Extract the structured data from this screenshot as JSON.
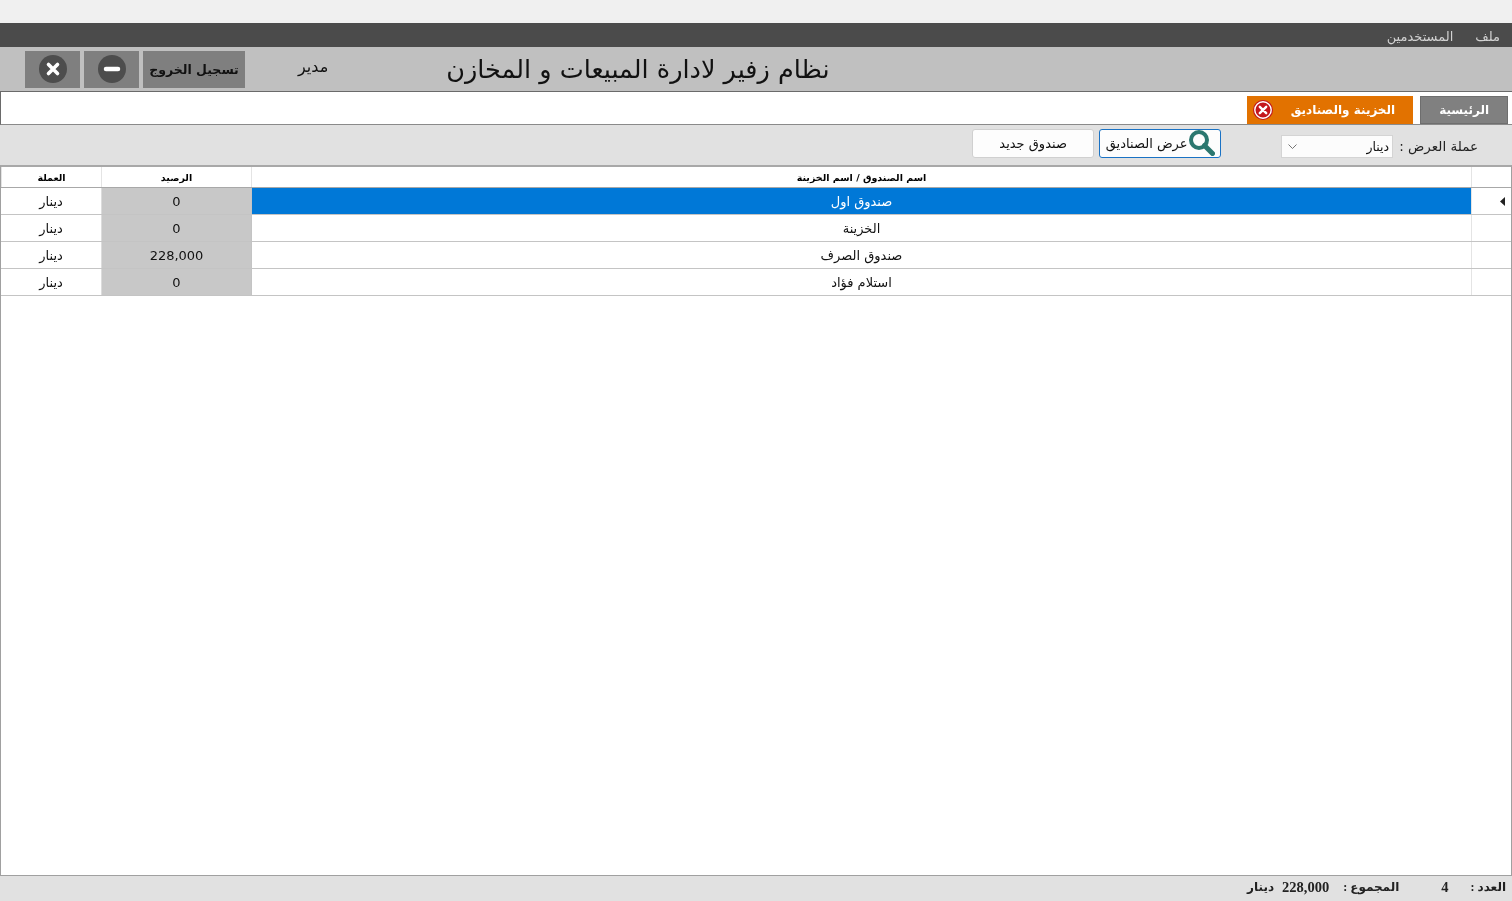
{
  "menu_bar": {
    "items": [
      "ملف",
      "المستخدمين"
    ]
  },
  "header": {
    "title": "نظام زفير لادارة المبيعات و المخازن",
    "user": "مدير",
    "logout_button": "تسجيل الخروج"
  },
  "tabs": [
    {
      "label": "الرئيسية",
      "selected": false,
      "closable": false
    },
    {
      "label": "الخزينة والصناديق",
      "selected": true,
      "closable": true
    }
  ],
  "toolbar": {
    "currency_label": "عملة العرض :",
    "currency_select": {
      "value": "دينار"
    },
    "buttons": [
      {
        "label": "عرض الصناديق",
        "kind": "search",
        "focused": true
      },
      {
        "label": "صندوق جديد",
        "kind": "plain",
        "focused": false
      }
    ]
  },
  "table": {
    "columns": [
      "اسم الصندوق / اسم الخزينة",
      "الرصيد",
      "العملة"
    ],
    "rows": [
      {
        "name": "صندوق اول",
        "balance": "0",
        "currency": "دينار",
        "selected": true
      },
      {
        "name": "الخزينة",
        "balance": "0",
        "currency": "دينار",
        "selected": false
      },
      {
        "name": "صندوق الصرف",
        "balance": "228,000",
        "currency": "دينار",
        "selected": false
      },
      {
        "name": "استلام فؤاد",
        "balance": "0",
        "currency": "دينار",
        "selected": false
      }
    ]
  },
  "status_bar": {
    "count_label": "العدد :",
    "count": "4",
    "total_label": "المجموع :",
    "total": "228,000",
    "total_currency": "دينار"
  }
}
